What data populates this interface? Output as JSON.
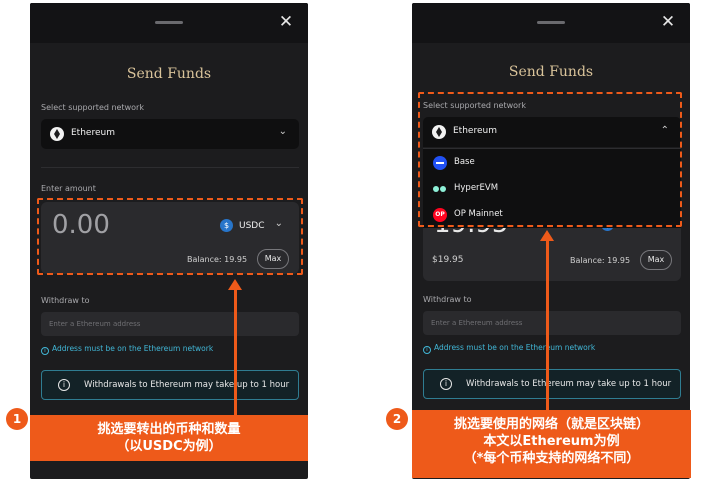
{
  "modal": {
    "title": "Send Funds",
    "close_glyph": "✕",
    "network_label": "Select supported network",
    "selected_network": "Ethereum",
    "amount_label": "Enter amount",
    "amount_value": "0.00",
    "token": "USDC",
    "balance": "Balance: 19.95",
    "max_label": "Max",
    "withdraw_label": "Withdraw to",
    "address_placeholder": "Enter a Ethereum address",
    "address_hint": "Address must be on the Ethereum network",
    "notice": "Withdrawals to Ethereum may take up to 1 hour"
  },
  "right_panel": {
    "partial_amount": "19.95",
    "usd_value": "$19.95",
    "dropdown_options": [
      {
        "label": "Base",
        "icon": "base-icon"
      },
      {
        "label": "HyperEVM",
        "icon": "hyperevm-icon"
      },
      {
        "label": "OP Mainnet",
        "icon": "op-mainnet-icon"
      }
    ]
  },
  "annotations": {
    "step1_number": "1",
    "step1_line1": "挑选要转出的币种和数量",
    "step1_line2": "（以USDC为例）",
    "step2_number": "2",
    "step2_line1": "挑选要使用的网络（就是区块链）",
    "step2_line2": "本文以Ethereum为例",
    "step2_line3": "（*每个币种支持的网络不同）"
  },
  "colors": {
    "accent_orange": "#ee5a1a",
    "modal_bg": "#1c1c1e",
    "title_gold": "#d9c39a",
    "hint_cyan": "#41b6d6",
    "usdc_blue": "#2775ca"
  }
}
